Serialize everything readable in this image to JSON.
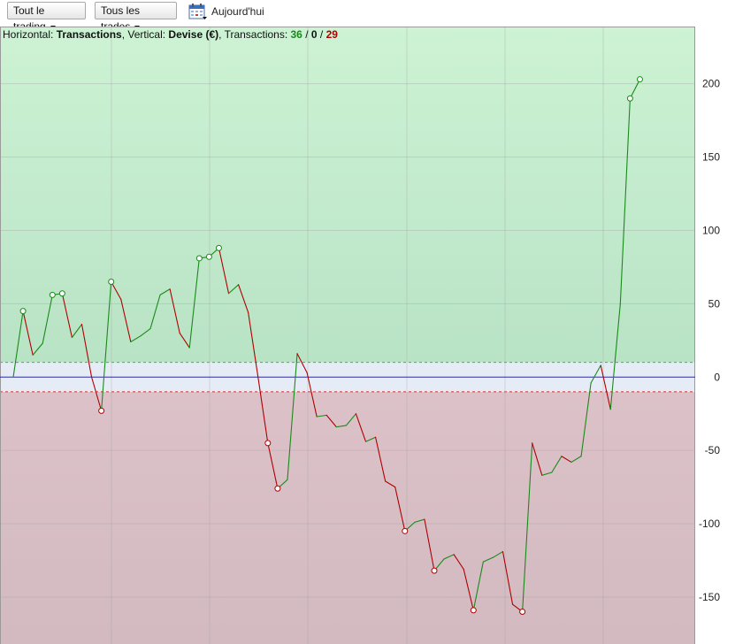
{
  "toolbar": {
    "period_select": "Tout le trading",
    "trades_select": "Tous les trades",
    "date_label": "Aujourd'hui"
  },
  "info": {
    "horizontal_label": "Horizontal: ",
    "horizontal_value": "Transactions",
    "vertical_label": ", Vertical: ",
    "vertical_value": "Devise (€)",
    "transactions_label": ", Transactions: ",
    "wins": "36",
    "sep1": " / ",
    "breakeven": "0",
    "sep2": " / ",
    "losses": "29"
  },
  "colors": {
    "profit_zone": "#c6efcf",
    "loss_zone": "#dcc0c6",
    "neutral_band": "#e6ecf6",
    "zero_line": "#2a2aa8",
    "up_segment": "#1a8a1a",
    "down_segment": "#b00000",
    "wins_text": "#1a8a1a",
    "losses_text": "#b00000"
  },
  "chart_data": {
    "type": "line",
    "x": [
      0,
      1,
      2,
      3,
      4,
      5,
      6,
      7,
      8,
      9,
      10,
      11,
      12,
      13,
      14,
      15,
      16,
      17,
      18,
      19,
      20,
      21,
      22,
      23,
      24,
      25,
      26,
      27,
      28,
      29,
      30,
      31,
      32,
      33,
      34,
      35,
      36,
      37,
      38,
      39,
      40,
      41,
      42,
      43,
      44,
      45,
      46,
      47,
      48,
      49,
      50,
      51,
      52,
      53,
      54,
      55,
      56,
      57,
      58,
      59,
      60,
      61,
      62,
      63,
      64,
      65,
      66
    ],
    "values": [
      0,
      45,
      15,
      23,
      56,
      57,
      27,
      36,
      0,
      -23,
      65,
      53,
      24,
      28,
      33,
      56,
      60,
      30,
      20,
      81,
      82,
      88,
      57,
      63,
      44,
      0,
      -45,
      -76,
      -70,
      16,
      3,
      -27,
      -26,
      -34,
      -33,
      -25,
      -44,
      -41,
      -71,
      -75,
      -105,
      -99,
      -97,
      -132,
      -124,
      -121,
      -131,
      -159,
      -126,
      -123,
      -119,
      -155,
      -160,
      -45,
      -67,
      -65,
      -54,
      -58,
      -54,
      -4,
      8,
      -22,
      50,
      190,
      203
    ],
    "markers": [
      1,
      4,
      5,
      9,
      10,
      19,
      20,
      21,
      26,
      27,
      40,
      43,
      47,
      52,
      63,
      64
    ],
    "yticks": [
      -150,
      -100,
      -50,
      0,
      50,
      100,
      150,
      200
    ],
    "ylim": [
      -182,
      239
    ],
    "neutral_band": [
      -10,
      10
    ],
    "grid": true
  }
}
